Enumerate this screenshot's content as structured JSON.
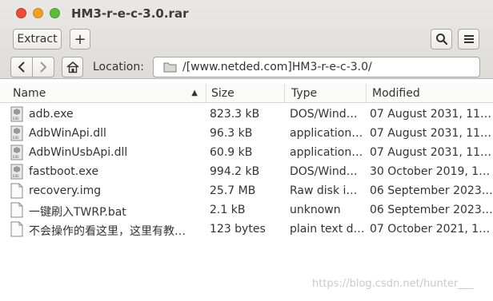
{
  "window": {
    "title": "HM3-r-e-c-3.0.rar"
  },
  "toolbar": {
    "extract_label": "Extract",
    "add_label": "+",
    "search_icon": "search-icon",
    "menu_icon": "hamburger-menu-icon"
  },
  "location": {
    "label": "Location:",
    "value": "/[www.netded.com]HM3-r-e-c-3.0/"
  },
  "columns": [
    "Name",
    "Size",
    "Type",
    "Modified"
  ],
  "files": [
    {
      "name": "adb.exe",
      "size": "823.3 kB",
      "type": "DOS/Wind…",
      "modified": "07 August 2031, 11…",
      "icon": "exe-icon"
    },
    {
      "name": "AdbWinApi.dll",
      "size": "96.3 kB",
      "type": "application…",
      "modified": "07 August 2031, 11…",
      "icon": "exe-icon"
    },
    {
      "name": "AdbWinUsbApi.dll",
      "size": "60.9 kB",
      "type": "application…",
      "modified": "07 August 2031, 11…",
      "icon": "exe-icon"
    },
    {
      "name": "fastboot.exe",
      "size": "994.2 kB",
      "type": "DOS/Wind…",
      "modified": "30 October 2019, 1…",
      "icon": "exe-icon"
    },
    {
      "name": "recovery.img",
      "size": "25.7 MB",
      "type": "Raw disk i…",
      "modified": "06 September 2023…",
      "icon": "file-icon"
    },
    {
      "name": "一键刷入TWRP.bat",
      "size": "2.1 kB",
      "type": "unknown",
      "modified": "06 September 2023…",
      "icon": "file-icon"
    },
    {
      "name": "不会操作的看这里，这里有教…",
      "size": "123 bytes",
      "type": "plain text d…",
      "modified": "07 October 2021, 1…",
      "icon": "file-icon"
    }
  ],
  "watermark": "https://blog.csdn.net/hunter___"
}
